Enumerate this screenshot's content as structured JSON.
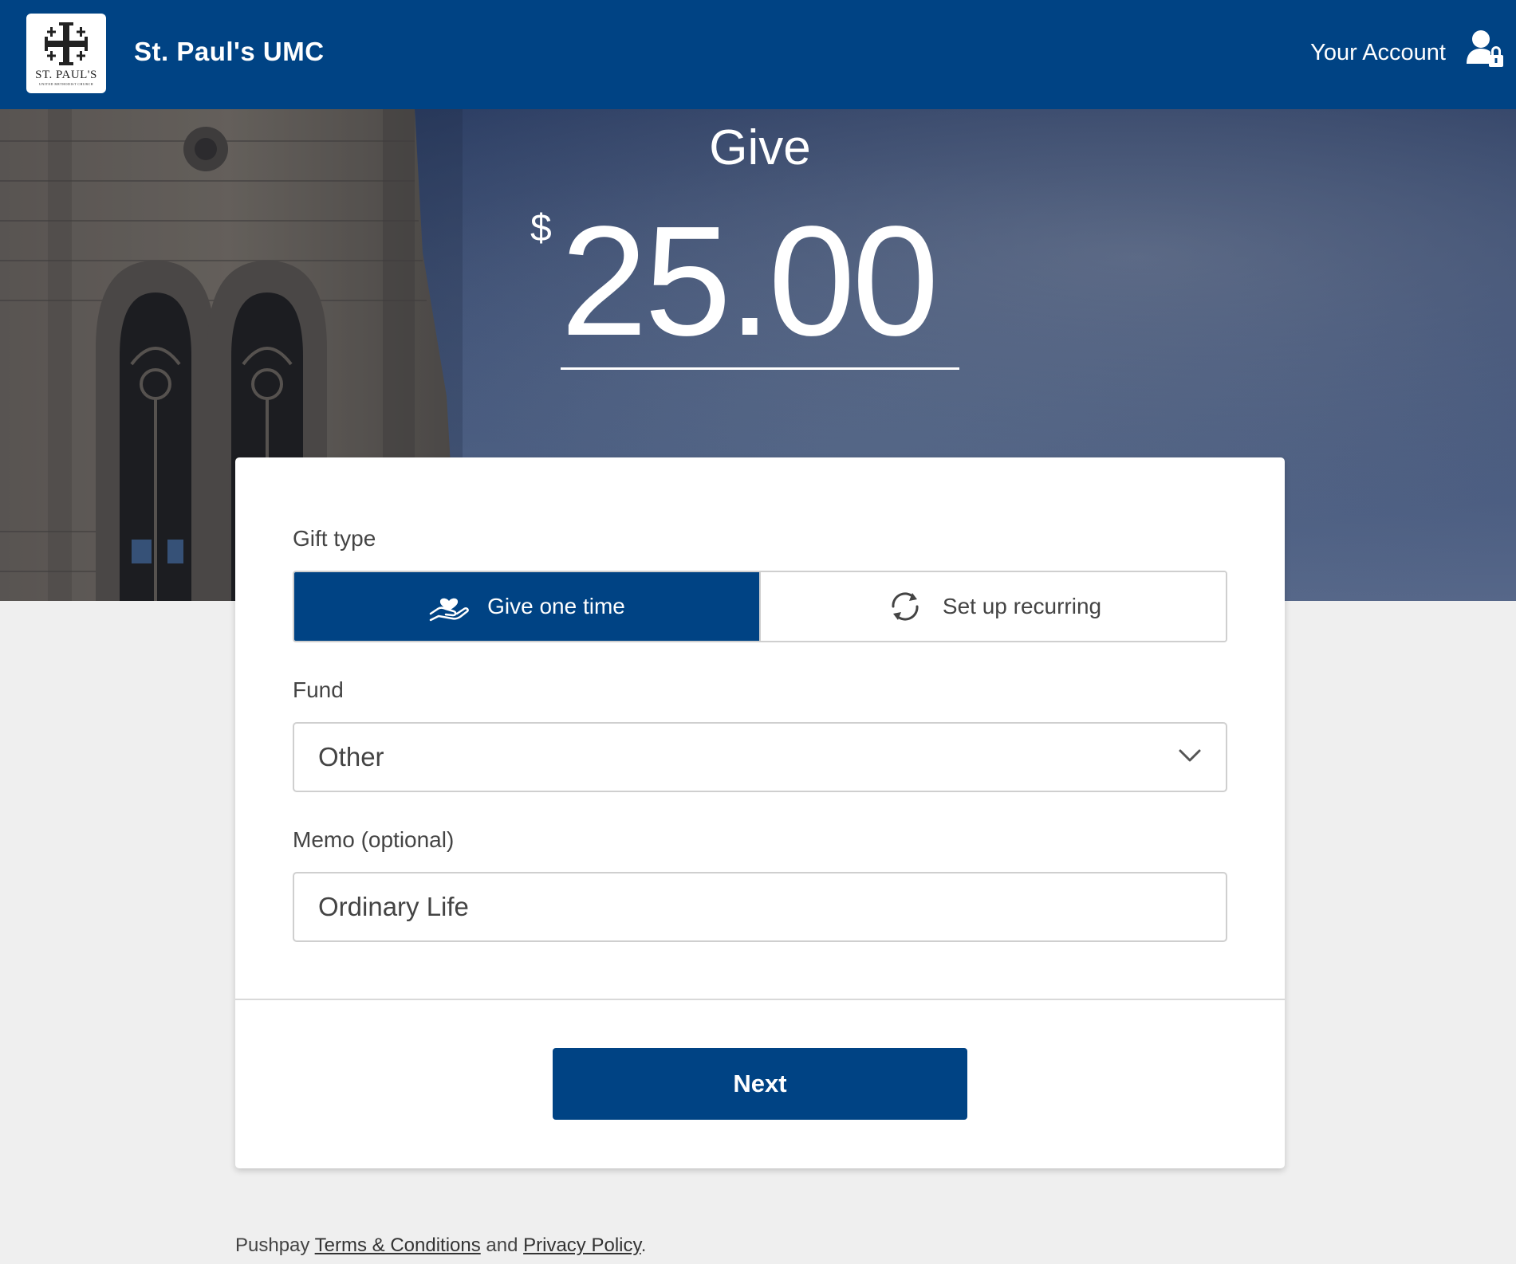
{
  "header": {
    "logo_text": "ST. PAUL'S",
    "logo_subtext": "UNITED METHODIST CHURCH",
    "org_name": "St. Paul's UMC",
    "account_label": "Your Account"
  },
  "hero": {
    "title": "Give",
    "currency_symbol": "$",
    "amount": "25.00"
  },
  "form": {
    "gift_type_label": "Gift type",
    "gift_types": [
      {
        "label": "Give one time",
        "icon": "hand-heart-icon",
        "selected": true
      },
      {
        "label": "Set up recurring",
        "icon": "recurring-arrows-icon",
        "selected": false
      }
    ],
    "fund_label": "Fund",
    "fund_value": "Other",
    "memo_label": "Memo (optional)",
    "memo_value": "Ordinary Life",
    "next_label": "Next"
  },
  "footer": {
    "prefix": "Pushpay",
    "terms_link": "Terms & Conditions",
    "and_text": "and",
    "privacy_link": "Privacy Policy",
    "suffix": "."
  },
  "colors": {
    "brand_blue": "#004384",
    "page_bg": "#efefef"
  }
}
